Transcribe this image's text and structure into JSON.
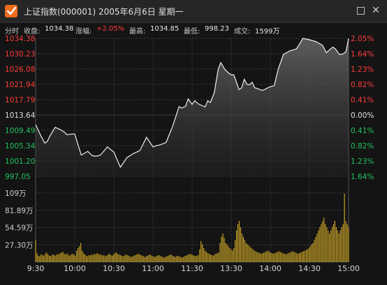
{
  "window": {
    "title": "上证指数(000001) 2005年6月6日 星期一",
    "maximize_icon": "square-icon",
    "close_icon": "close-icon",
    "close_glyph": "✕"
  },
  "info": {
    "mode": "分时",
    "close_label": "收盘:",
    "close_value": "1034.38",
    "change_label": "涨幅:",
    "change_value": "+2.05%",
    "high_label": "最高:",
    "high_value": "1034.85",
    "low_label": "最低:",
    "low_value": "998.23",
    "volume_label": "成交:",
    "volume_value": "1599万"
  },
  "colors": {
    "up": "#ff3b3b",
    "down": "#22c35e",
    "flat": "#e0e0e0",
    "line": "#f0f0f0",
    "volume_bar": "#c9a227",
    "grid": "#3a3a3a",
    "background": "#141414"
  },
  "chart_data": {
    "type": "area",
    "price_axis": {
      "left_ticks": [
        "1034.38",
        "1030.23",
        "1026.08",
        "1021.94",
        "1017.79",
        "1013.64",
        "1009.49",
        "1005.34",
        "1001.20",
        "997.05"
      ],
      "right_ticks": [
        "2.05%",
        "1.64%",
        "1.23%",
        "0.82%",
        "0.41%",
        "0.00%",
        "0.41%",
        "0.82%",
        "1.23%",
        "1.64%"
      ],
      "ylim": [
        997.05,
        1034.38
      ],
      "prev_close": 1013.64
    },
    "volume_axis": {
      "ticks": [
        "109万",
        "81.89万",
        "54.59万",
        "27.30万"
      ],
      "ylim": [
        0,
        109
      ]
    },
    "x_ticks": [
      "9:30",
      "10:00",
      "10:30",
      "11:00",
      "11:30",
      "13:30",
      "14:00",
      "14:30",
      "15:00"
    ],
    "x_tick_minutes": [
      0,
      30,
      60,
      90,
      120,
      150,
      180,
      210,
      240
    ],
    "price_series": {
      "minute": [
        0,
        4,
        7,
        9,
        11,
        15,
        20,
        22,
        24,
        28,
        30,
        35,
        40,
        43,
        45,
        48,
        50,
        55,
        60,
        65,
        70,
        75,
        80,
        85,
        90,
        93,
        95,
        100,
        105,
        110,
        112,
        115,
        117,
        120,
        122,
        125,
        130,
        132,
        134,
        137,
        140,
        142,
        145,
        148,
        150,
        152,
        154,
        156,
        158,
        160,
        162,
        164,
        166,
        168,
        170,
        172,
        174,
        176,
        178,
        180,
        183,
        186,
        190,
        195,
        200,
        205,
        210,
        215,
        220,
        223,
        226,
        228,
        230,
        233,
        236,
        238,
        240
      ],
      "values": [
        1011.0,
        1008.0,
        1006.0,
        1006.5,
        1008.0,
        1010.3,
        1009.5,
        1009.0,
        1008.3,
        1008.5,
        1008.5,
        1002.8,
        1003.8,
        1002.7,
        1002.5,
        1002.6,
        1002.9,
        1005.0,
        1003.6,
        999.5,
        1002.1,
        1003.2,
        1004.0,
        1007.6,
        1005.0,
        1005.4,
        1005.5,
        1006.2,
        1010.5,
        1015.9,
        1015.5,
        1016.0,
        1018.0,
        1016.5,
        1017.5,
        1016.6,
        1015.8,
        1017.5,
        1017.0,
        1019.6,
        1026.0,
        1027.8,
        1026.0,
        1025.0,
        1024.5,
        1024.5,
        1022.5,
        1020.5,
        1021.0,
        1023.3,
        1022.0,
        1021.8,
        1022.5,
        1021.0,
        1020.8,
        1020.5,
        1020.3,
        1020.6,
        1021.0,
        1021.3,
        1021.6,
        1026.0,
        1030.0,
        1031.0,
        1031.5,
        1034.38,
        1034.0,
        1033.5,
        1032.5,
        1030.5,
        1031.5,
        1032.0,
        1031.5,
        1030.0,
        1030.2,
        1030.8,
        1034.38
      ],
      "values_note_removed": true
    },
    "volume_series": {
      "minute_step": 1,
      "values": [
        35,
        14,
        10,
        9,
        12,
        11,
        10,
        13,
        15,
        12,
        10,
        9,
        11,
        12,
        10,
        11,
        13,
        12,
        14,
        15,
        16,
        13,
        12,
        14,
        11,
        10,
        12,
        13,
        12,
        10,
        18,
        22,
        25,
        30,
        18,
        14,
        12,
        10,
        9,
        11,
        10,
        12,
        11,
        13,
        12,
        14,
        13,
        11,
        12,
        10,
        11,
        9,
        10,
        12,
        13,
        11,
        10,
        12,
        14,
        15,
        13,
        12,
        11,
        10,
        9,
        10,
        12,
        11,
        10,
        9,
        8,
        9,
        10,
        11,
        12,
        13,
        12,
        11,
        10,
        9,
        8,
        9,
        10,
        11,
        12,
        10,
        9,
        8,
        9,
        10,
        11,
        10,
        9,
        8,
        7,
        8,
        9,
        10,
        11,
        12,
        10,
        9,
        8,
        9,
        10,
        9,
        8,
        7,
        8,
        9,
        10,
        11,
        12,
        13,
        12,
        11,
        10,
        9,
        10,
        11,
        20,
        33,
        28,
        22,
        18,
        16,
        14,
        13,
        12,
        11,
        10,
        12,
        13,
        14,
        15,
        30,
        40,
        45,
        38,
        30,
        28,
        25,
        22,
        20,
        18,
        22,
        35,
        50,
        60,
        65,
        55,
        45,
        40,
        35,
        30,
        28,
        26,
        24,
        22,
        20,
        18,
        17,
        16,
        15,
        14,
        13,
        14,
        15,
        16,
        17,
        18,
        16,
        15,
        14,
        13,
        14,
        15,
        16,
        17,
        16,
        15,
        14,
        13,
        12,
        13,
        14,
        15,
        16,
        17,
        16,
        15,
        14,
        13,
        14,
        15,
        16,
        17,
        18,
        19,
        20,
        22,
        25,
        28,
        30,
        35,
        40,
        45,
        50,
        55,
        60,
        65,
        70,
        60,
        55,
        50,
        45,
        50,
        55,
        60,
        65,
        55,
        50,
        45,
        50,
        55,
        60,
        108,
        65,
        60,
        55
      ]
    }
  }
}
